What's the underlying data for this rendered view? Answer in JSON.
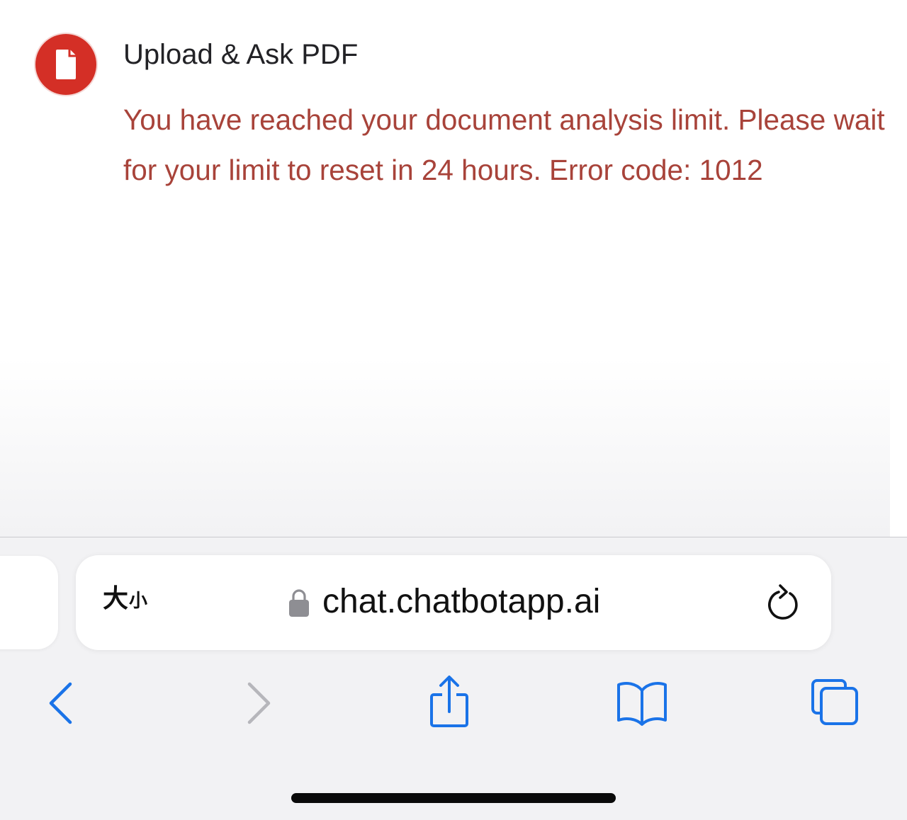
{
  "message": {
    "sender": "Upload & Ask PDF",
    "avatar_icon": "document-icon",
    "avatar_color": "#d42f26",
    "error_text": "You have reached your document analysis limit. Please wait for your limit to reset in 24 hours. Error code: 1012",
    "error_color": "#a8433a"
  },
  "browser": {
    "text_size_big": "大",
    "text_size_small": "小",
    "url": "chat.chatbotapp.ai",
    "accent_color": "#1a73e8",
    "icons": {
      "lock": "lock-icon",
      "reload": "reload-icon",
      "back": "chevron-left-icon",
      "forward": "chevron-right-icon",
      "share": "share-icon",
      "bookmarks": "book-icon",
      "tabs": "tabs-icon"
    }
  }
}
